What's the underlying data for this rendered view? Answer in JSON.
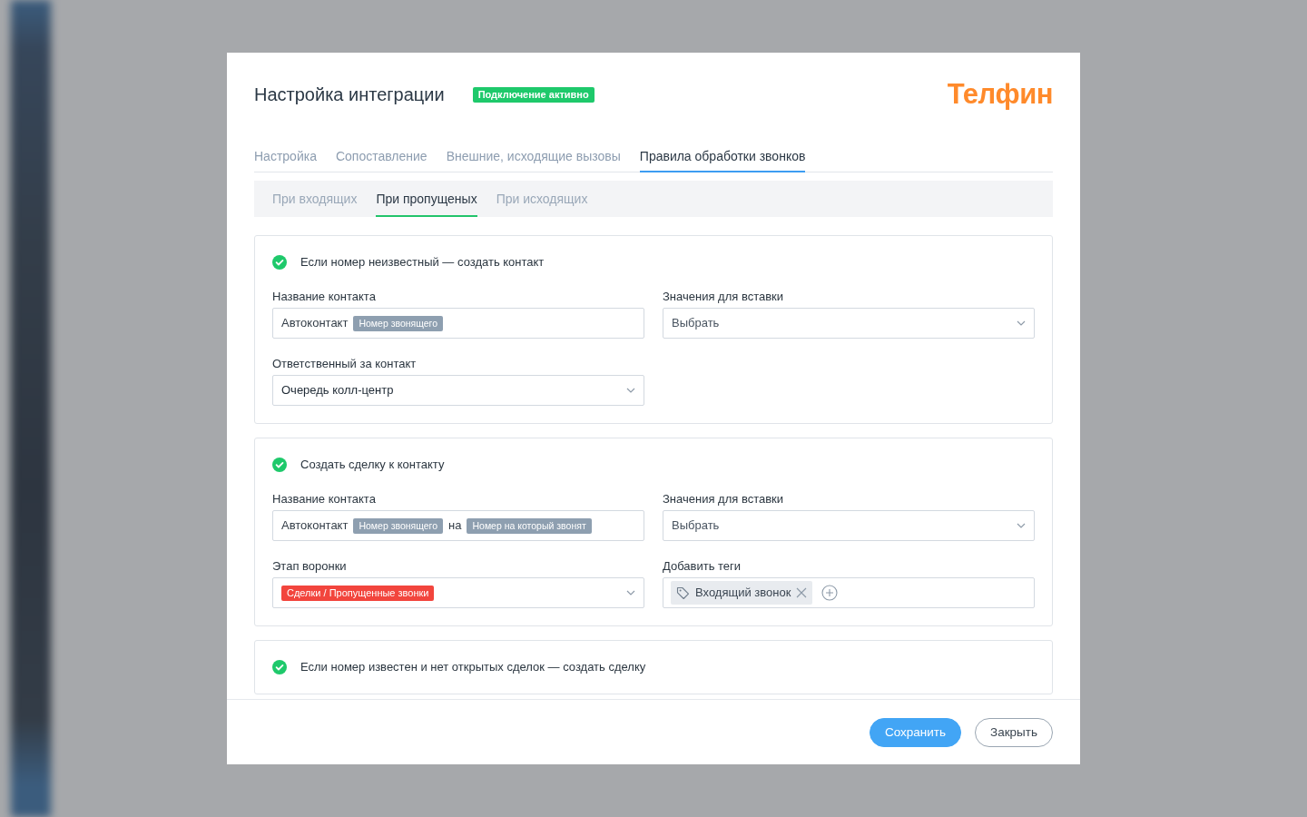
{
  "modal": {
    "title": "Настройка интеграции",
    "status_badge": "Подключение активно",
    "logo": "Телфин",
    "tabs": [
      {
        "label": "Настройка",
        "selected": false
      },
      {
        "label": "Сопоставление",
        "selected": false
      },
      {
        "label": "Внешние, исходящие вызовы",
        "selected": false
      },
      {
        "label": "Правила обработки звонков",
        "selected": true
      }
    ],
    "subtabs": [
      {
        "label": "При входящих",
        "selected": false
      },
      {
        "label": "При пропущеных",
        "selected": true
      },
      {
        "label": "При исходящих",
        "selected": false
      }
    ],
    "rules": [
      {
        "title": "Если номер неизвестный — создать контакт",
        "checked": true,
        "fields": [
          {
            "kind": "tokens",
            "label": "Название контакта",
            "parts": [
              {
                "kind": "text",
                "text": "Автоконтакт"
              },
              {
                "kind": "chip",
                "text": "Номер звонящего"
              }
            ]
          },
          {
            "kind": "select",
            "label": "Значения для вставки",
            "placeholder": "Выбрать"
          },
          {
            "kind": "select",
            "label": "Ответственный за контакт",
            "value": "Очередь колл-центр"
          }
        ]
      },
      {
        "title": "Создать сделку к контакту",
        "checked": true,
        "fields": [
          {
            "kind": "tokens",
            "label": "Название контакта",
            "parts": [
              {
                "kind": "text",
                "text": "Автоконтакт"
              },
              {
                "kind": "chip",
                "text": "Номер звонящего"
              },
              {
                "kind": "text",
                "text": "на"
              },
              {
                "kind": "chip",
                "text": "Номер на который звонят"
              }
            ]
          },
          {
            "kind": "select",
            "label": "Значения для вставки",
            "placeholder": "Выбрать"
          },
          {
            "kind": "stage",
            "label": "Этап воронки",
            "value": "Сделки / Пропущенные звонки"
          },
          {
            "kind": "tags",
            "label": "Добавить теги",
            "tags": [
              "Входящий звонок"
            ]
          }
        ]
      },
      {
        "title": "Если номер известен и нет открытых сделок — создать сделку",
        "checked": true
      }
    ],
    "buttons": [
      {
        "kind": "primary",
        "label": "Сохранить"
      },
      {
        "kind": "secondary",
        "label": "Закрыть"
      }
    ]
  }
}
